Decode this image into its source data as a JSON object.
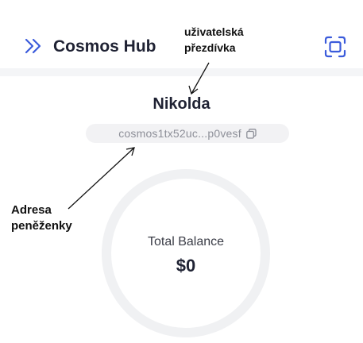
{
  "header": {
    "menu_icon": "double-chevron-right-icon",
    "title": "Cosmos Hub",
    "scan_icon": "scan-frame-icon"
  },
  "annotations": {
    "nickname_label_line1": "uživatelská",
    "nickname_label_line2": "přezdívka",
    "wallet_label_line1": "Adresa",
    "wallet_label_line2": "peněženky"
  },
  "account": {
    "nickname": "Nikolda",
    "address": "cosmos1tx52uc...p0vesf",
    "copy_icon": "copy-icon"
  },
  "balance": {
    "label": "Total Balance",
    "value": "$0"
  },
  "colors": {
    "accent": "#3b5bdb",
    "title": "#1f2233",
    "muted": "#8d8f98"
  }
}
